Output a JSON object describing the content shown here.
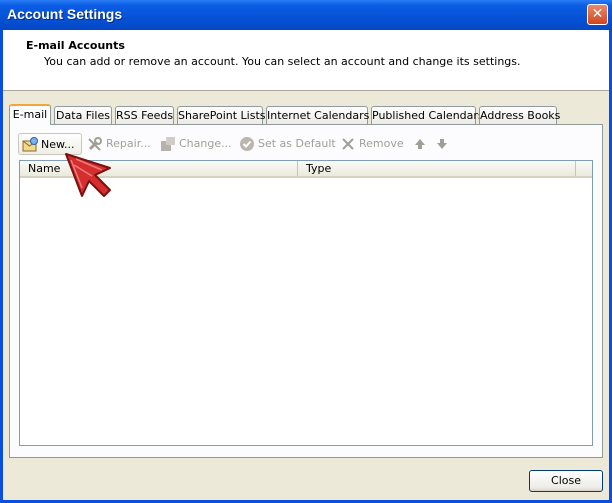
{
  "window": {
    "title": "Account Settings",
    "close_glyph": "✕"
  },
  "header": {
    "title": "E-mail Accounts",
    "description": "You can add or remove an account. You can select an account and change its settings."
  },
  "tabs": [
    {
      "label": "E-mail",
      "active": true
    },
    {
      "label": "Data Files",
      "active": false
    },
    {
      "label": "RSS Feeds",
      "active": false
    },
    {
      "label": "SharePoint Lists",
      "active": false
    },
    {
      "label": "Internet Calendars",
      "active": false
    },
    {
      "label": "Published Calendars",
      "active": false
    },
    {
      "label": "Address Books",
      "active": false
    }
  ],
  "toolbar": {
    "new_label": "New...",
    "repair_label": "Repair...",
    "change_label": "Change...",
    "set_default_label": "Set as Default",
    "remove_label": "Remove"
  },
  "list": {
    "columns": [
      "Name",
      "Type"
    ],
    "rows": []
  },
  "footer": {
    "close_label": "Close"
  },
  "colors": {
    "titlebar": "#0552d6",
    "client": "#ece9d8",
    "active_tab_accent": "#f3a53b",
    "cursor_arrow": "#d42e2e"
  }
}
